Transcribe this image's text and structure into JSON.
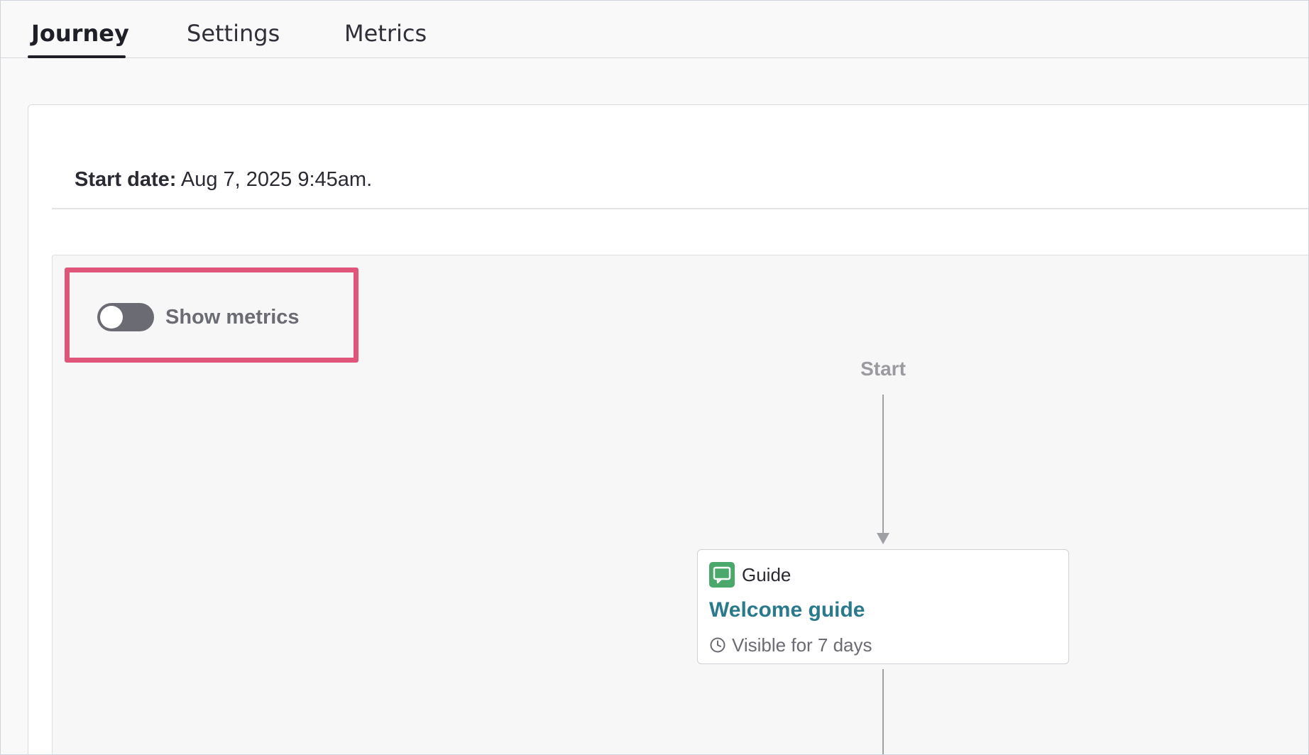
{
  "tabs": [
    {
      "label": "Journey",
      "active": true
    },
    {
      "label": "Settings",
      "active": false
    },
    {
      "label": "Metrics",
      "active": false
    }
  ],
  "journey": {
    "start_date_label": "Start date:",
    "start_date_value": "Aug 7, 2025 9:45am."
  },
  "canvas": {
    "toggle": {
      "label": "Show metrics",
      "on": false
    },
    "start_label": "Start",
    "node": {
      "type": "Guide",
      "icon": "guide-chat-icon",
      "title": "Welcome guide",
      "meta_icon": "clock-icon",
      "meta": "Visible for 7 days"
    }
  },
  "colors": {
    "highlight": "#e0567a",
    "guide_icon_bg": "#4aa86a",
    "node_title": "#2b7a8c",
    "toggle_off": "#6b6b73"
  }
}
